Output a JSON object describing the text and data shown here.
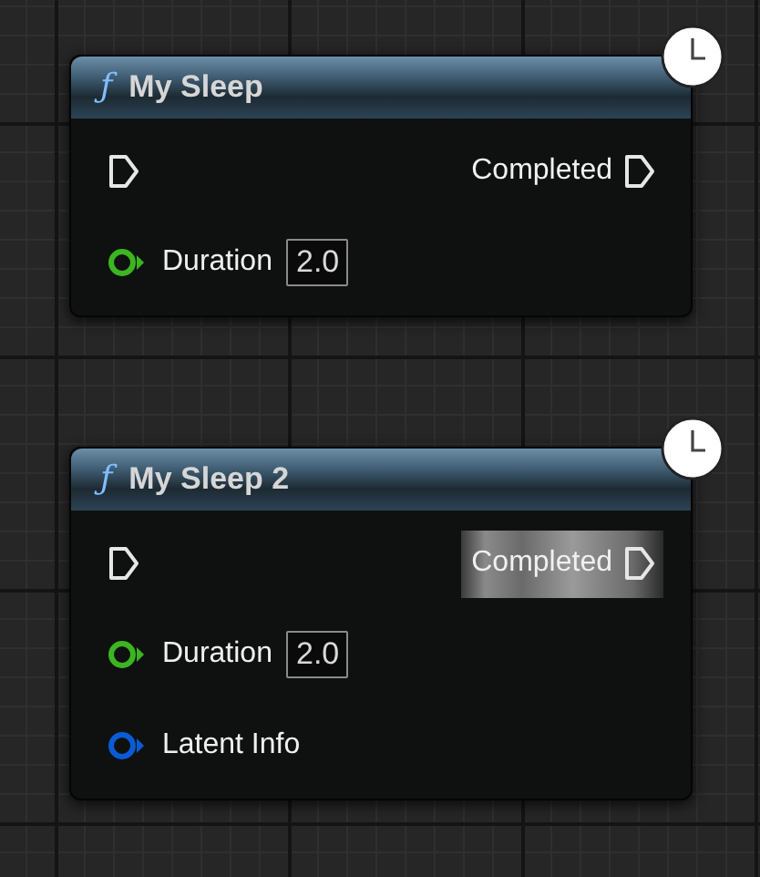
{
  "nodes": [
    {
      "title": "My Sleep",
      "icon": "ƒ",
      "latent": true,
      "pins": [
        {
          "kind": "exec",
          "output_label": "Completed",
          "highlighted": false
        },
        {
          "kind": "data",
          "label": "Duration",
          "color": "#3cb521",
          "value": "2.0"
        }
      ]
    },
    {
      "title": "My Sleep 2",
      "icon": "ƒ",
      "latent": true,
      "pins": [
        {
          "kind": "exec",
          "output_label": "Completed",
          "highlighted": true
        },
        {
          "kind": "data",
          "label": "Duration",
          "color": "#3cb521",
          "value": "2.0"
        },
        {
          "kind": "data",
          "label": "Latent Info",
          "color": "#0a5bd6"
        }
      ]
    }
  ]
}
